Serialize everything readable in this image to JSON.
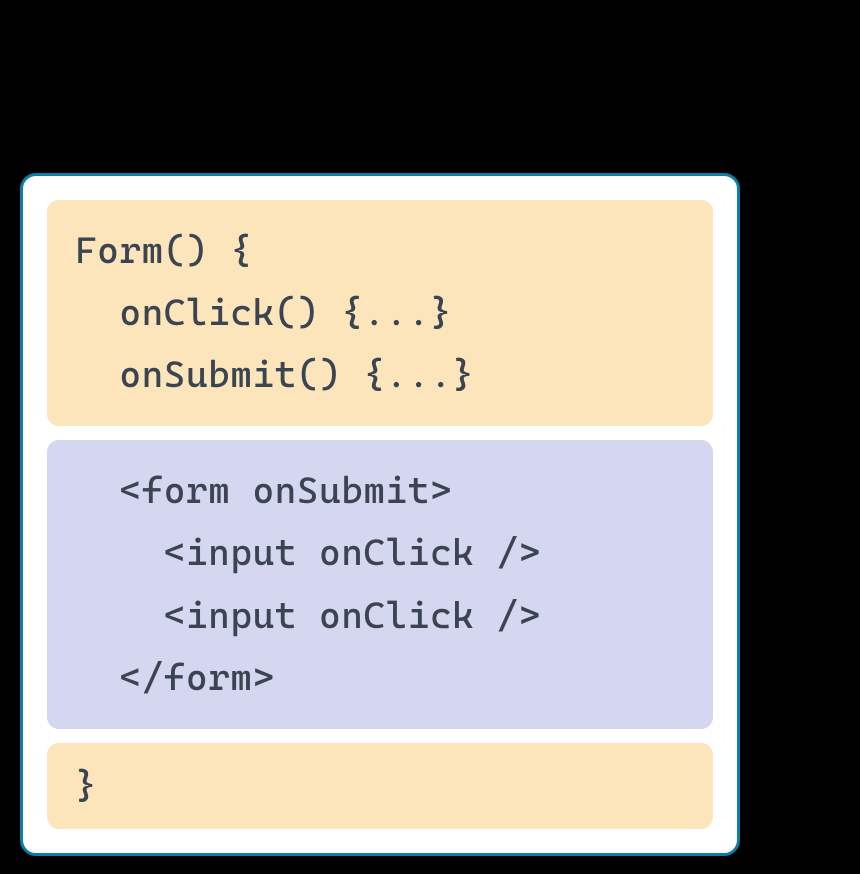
{
  "component": {
    "block1": {
      "line1": "Form() {",
      "line2": "onClick() {...}",
      "line3": "onSubmit() {...}"
    },
    "block2": {
      "line1": "<form onSubmit>",
      "line2": "<input onClick />",
      "line3": "<input onClick />",
      "line4": "</form>"
    },
    "block3": {
      "line1": "}"
    }
  }
}
